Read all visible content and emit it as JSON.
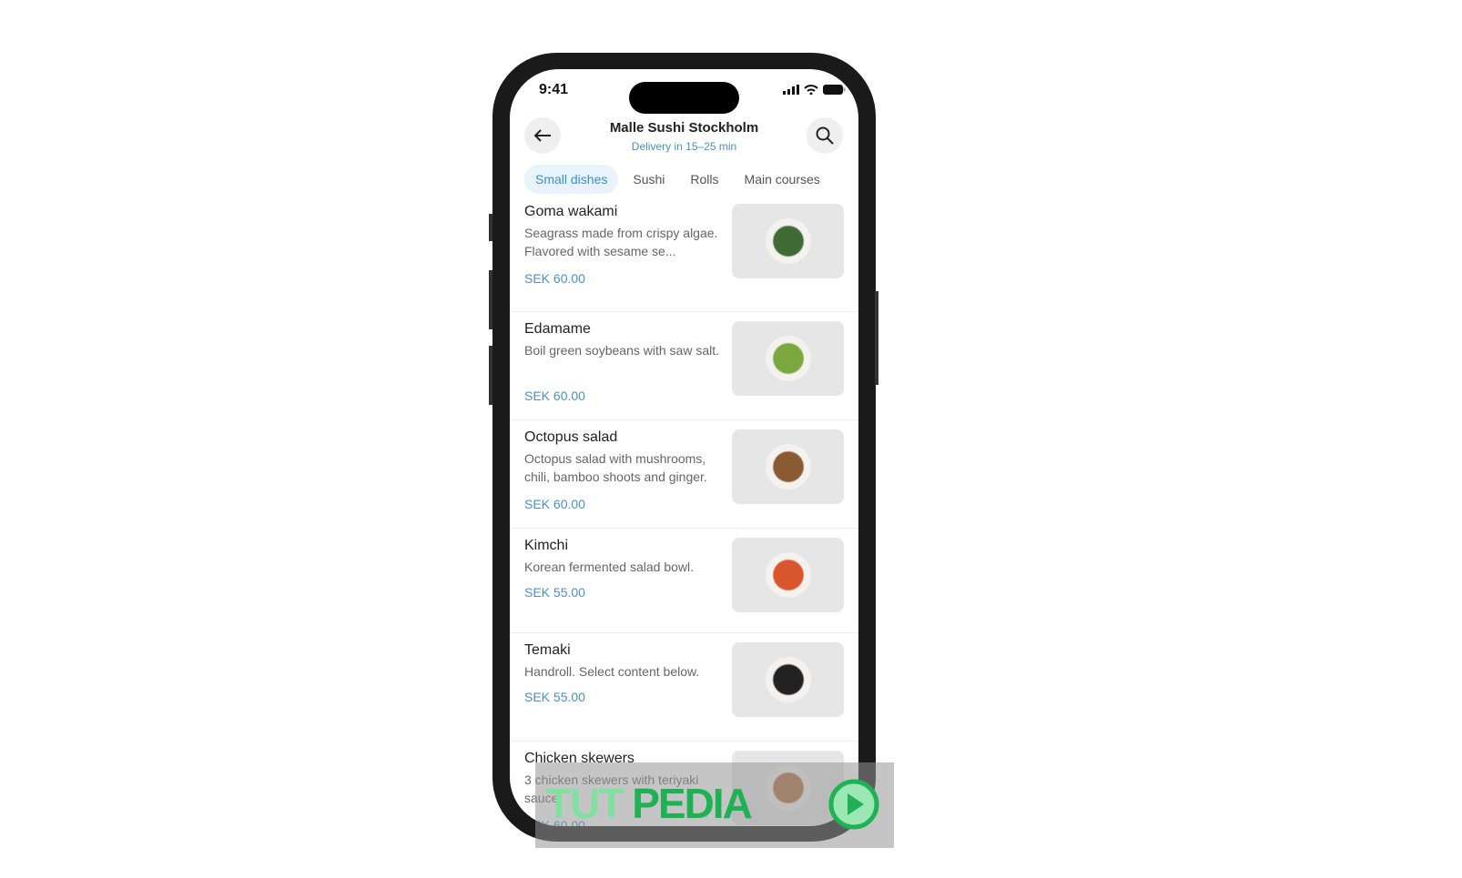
{
  "status": {
    "time": "9:41"
  },
  "header": {
    "title": "Malle Sushi Stockholm",
    "subtitle": "Delivery in 15–25 min"
  },
  "tabs": [
    {
      "label": "Small dishes",
      "active": true
    },
    {
      "label": "Sushi"
    },
    {
      "label": "Rolls"
    },
    {
      "label": "Main courses"
    }
  ],
  "items": [
    {
      "name": "Goma wakami",
      "desc": "Seagrass made from crispy algae. Flavored with sesame se...",
      "price": "SEK 60.00",
      "color": "#3f6b34"
    },
    {
      "name": "Edamame",
      "desc": "Boil green soybeans with saw salt.",
      "price": "SEK 60.00",
      "color": "#7ba83e"
    },
    {
      "name": "Octopus salad",
      "desc": "Octopus salad with mushrooms, chili, bamboo shoots and ginger.",
      "price": "SEK 60.00",
      "color": "#8a5a32"
    },
    {
      "name": "Kimchi",
      "desc": "Korean fermented salad bowl.",
      "price": "SEK 55.00",
      "color": "#d8552e"
    },
    {
      "name": "Temaki",
      "desc": "Handroll. Select content below.",
      "price": "SEK 55.00",
      "color": "#222222"
    },
    {
      "name": "Chicken skewers",
      "desc": "3 chicken skewers with teriyaki sauce.",
      "price": "SEK 60.00",
      "color": "#b06a3a"
    }
  ],
  "watermark": {
    "text_a": "TUT",
    "text_b": "PEDIA"
  }
}
